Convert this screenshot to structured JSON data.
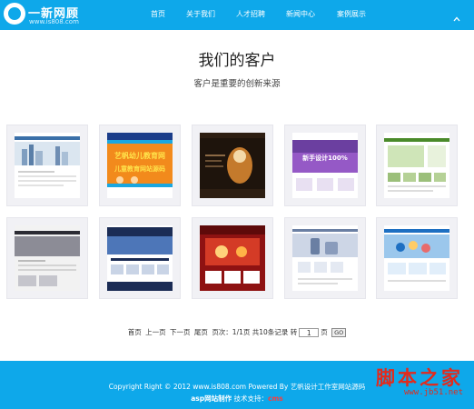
{
  "header": {
    "brand": "一新网顾",
    "url": "www.is808.com",
    "nav": [
      {
        "label": "首页"
      },
      {
        "label": "关于我们"
      },
      {
        "label": "人才招聘"
      },
      {
        "label": "新闻中心"
      },
      {
        "label": "案例展示"
      }
    ],
    "toggle_icon": "chevron-up-icon"
  },
  "main": {
    "title": "我们的客户",
    "subtitle": "客户是重要的创新来源",
    "clients": [
      {
        "theme": "city-corporate-site",
        "colors": [
          "#3a6fa8",
          "#dbe6f0",
          "#ffffff"
        ]
      },
      {
        "theme": "kids-education-site",
        "colors": [
          "#f28a1c",
          "#1aa7e0",
          "#ffe24a"
        ],
        "text": [
          "艺帆幼儿教育网",
          "儿童教育网站源码"
        ]
      },
      {
        "theme": "dark-portrait-site",
        "colors": [
          "#1e140c",
          "#c47a2c",
          "#f4d9a8"
        ]
      },
      {
        "theme": "purple-design-site",
        "colors": [
          "#6b3fa0",
          "#b06be0",
          "#ffffff"
        ],
        "text": [
          "新手设计100%"
        ]
      },
      {
        "theme": "green-portal-site",
        "colors": [
          "#4a8a2a",
          "#cfe5b8",
          "#ffffff"
        ]
      },
      {
        "theme": "dark-business-site",
        "colors": [
          "#2b2b33",
          "#8c8c96",
          "#f2f2f2"
        ]
      },
      {
        "theme": "navy-corporate-site",
        "colors": [
          "#1b2c55",
          "#4d76b8",
          "#ffffff"
        ]
      },
      {
        "theme": "red-restaurant-site",
        "colors": [
          "#8e1212",
          "#d43b26",
          "#ffd27a"
        ]
      },
      {
        "theme": "tech-products-site",
        "colors": [
          "#6a7fa3",
          "#cdd6e6",
          "#ffffff"
        ]
      },
      {
        "theme": "blue-team-site",
        "colors": [
          "#1d6fc2",
          "#9bc7ec",
          "#ffffff"
        ]
      }
    ]
  },
  "pager": {
    "first": "首页",
    "prev": "上一页",
    "next": "下一页",
    "last": "尾页",
    "info": "页次：1/1页 共10条记录 转",
    "input_value": "1",
    "page_unit": "页",
    "go_label": "GO"
  },
  "footer": {
    "copyright": "Copyright Right © 2012 www.is808.com Powered By 艺帆设计工作室网站源码",
    "credit_bold": "asp网站制作",
    "credit_text": "技术支持：",
    "credit_cms": "cms",
    "watermark_big": "脚本之家",
    "watermark_url": "www.jb51.net"
  }
}
